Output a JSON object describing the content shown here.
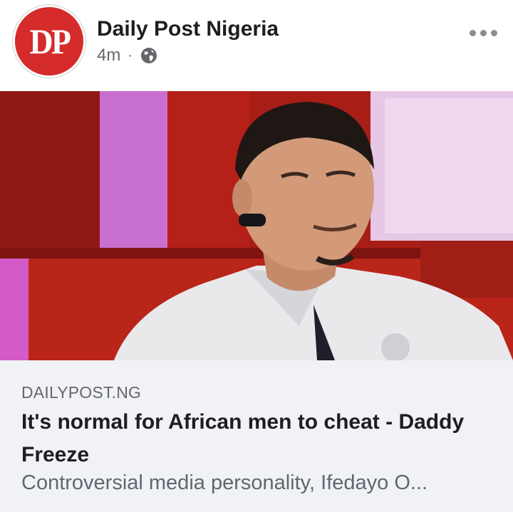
{
  "post": {
    "page_name": "Daily Post Nigeria",
    "avatar_text": "DP",
    "time": "4m",
    "separator": "·",
    "privacy_icon": "globe-icon",
    "more_icon": "more-options-icon"
  },
  "image": {
    "description_icon": "photo-image"
  },
  "link": {
    "domain": "DAILYPOST.NG",
    "title": "It's normal for African men to cheat - Daddy Freeze",
    "description": "Controversial media personality, Ifedayo O..."
  },
  "colors": {
    "brand_red": "#d52b2b",
    "text_primary": "#1c1e21",
    "text_secondary": "#65676b",
    "card_bg": "#f0f2f5"
  }
}
